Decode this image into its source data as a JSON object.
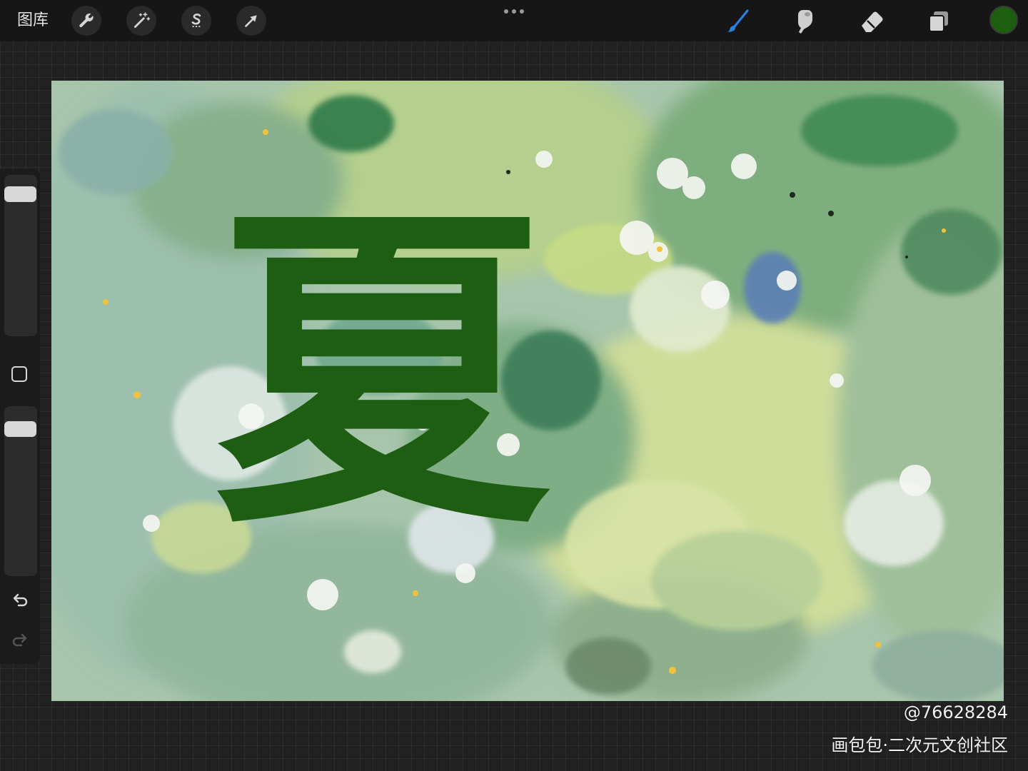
{
  "toolbar": {
    "gallery_label": "图库",
    "left_tools": [
      {
        "name": "actions",
        "icon": "wrench-icon"
      },
      {
        "name": "adjustments",
        "icon": "magic-wand-icon"
      },
      {
        "name": "selection",
        "icon": "selection-s-icon"
      },
      {
        "name": "transform",
        "icon": "arrow-cursor-icon"
      }
    ],
    "right_tools": [
      {
        "name": "brush",
        "icon": "brush-icon",
        "active": true
      },
      {
        "name": "smudge",
        "icon": "smudge-finger-icon",
        "active": false
      },
      {
        "name": "eraser",
        "icon": "eraser-icon",
        "active": false
      },
      {
        "name": "layers",
        "icon": "layers-icon",
        "active": false
      }
    ],
    "active_color": "#1d5e0f",
    "accent_color": "#2b7fe0"
  },
  "sidebar": {
    "brush_size_level": 0.06,
    "opacity_level": 0.08,
    "icons": [
      "modify-square-icon",
      "undo-icon",
      "redo-icon"
    ]
  },
  "canvas": {
    "handwritten_character": "夏",
    "stroke_color": "#1e5e12"
  },
  "watermark": {
    "user_id": "@76628284",
    "site": "画包包·二次元文创社区"
  }
}
